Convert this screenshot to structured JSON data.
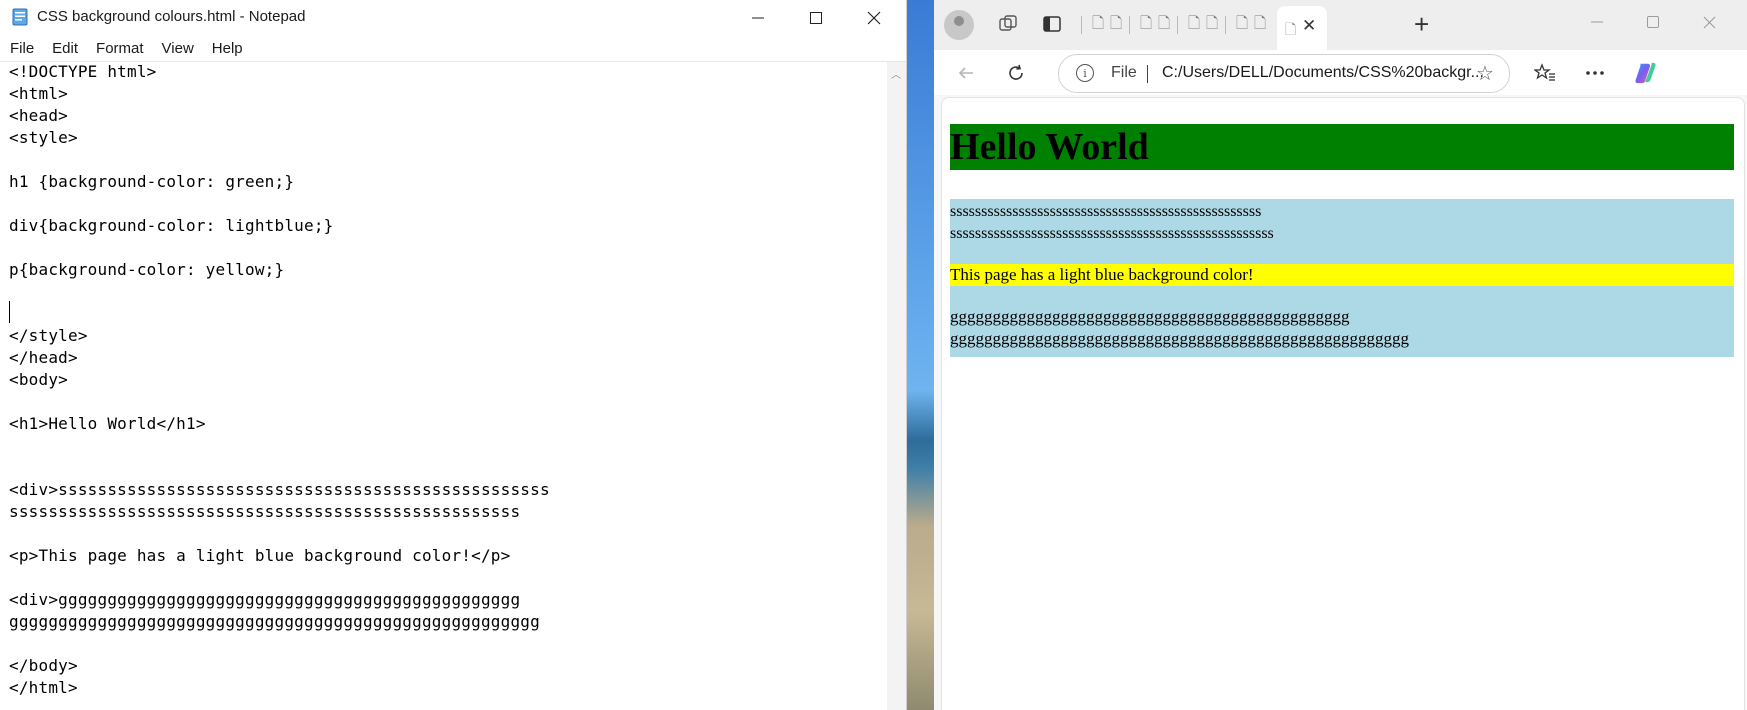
{
  "notepad": {
    "title": "CSS background colours.html - Notepad",
    "menu": [
      "File",
      "Edit",
      "Format",
      "View",
      "Help"
    ],
    "lines": [
      "<!DOCTYPE html>",
      "<html>",
      "<head>",
      "<style>",
      "",
      "h1 {background-color: green;}",
      "",
      "div{background-color: lightblue;}",
      "",
      "p{background-color: yellow;}",
      "",
      "",
      "</style>",
      "</head>",
      "<body>",
      "",
      "<h1>Hello World</h1>",
      "",
      "",
      "<div>ssssssssssssssssssssssssssssssssssssssssssssssssss",
      "ssssssssssssssssssssssssssssssssssssssssssssssssssss",
      "",
      "<p>This page has a light blue background color!</p>",
      "",
      "<div>ggggggggggggggggggggggggggggggggggggggggggggggg",
      "gggggggggggggggggggggggggggggggggggggggggggggggggggggg",
      "",
      "</body>",
      "</html>"
    ]
  },
  "browser": {
    "address_scheme": "File",
    "address_url": "C:/Users/DELL/Documents/CSS%20backgr...",
    "page": {
      "h1_text": "Hello World",
      "h1_bg": "#008000",
      "div_bg": "#add8e6",
      "p_bg": "#ffff00",
      "div1_text": "ssssssssssssssssssssssssssssssssssssssssssssssssss\nssssssssssssssssssssssssssssssssssssssssssssssssssss",
      "p_text": "This page has a light blue background color!",
      "div2_text": "ggggggggggggggggggggggggggggggggggggggggggggggg\ngggggggggggggggggggggggggggggggggggggggggggggggggggggg"
    }
  },
  "icons": {
    "notepad_app": "notepad-icon",
    "minimize": "minimize-icon",
    "maximize": "maximize-icon",
    "close": "close-icon",
    "profile": "profile-avatar-icon",
    "workspaces": "workspaces-icon",
    "tab_actions": "tab-actions-icon",
    "back": "back-arrow-icon",
    "refresh": "refresh-icon",
    "info": "info-icon",
    "favorite": "star-icon",
    "favorites": "favorites-icon",
    "more": "more-icon",
    "copilot": "copilot-icon"
  }
}
